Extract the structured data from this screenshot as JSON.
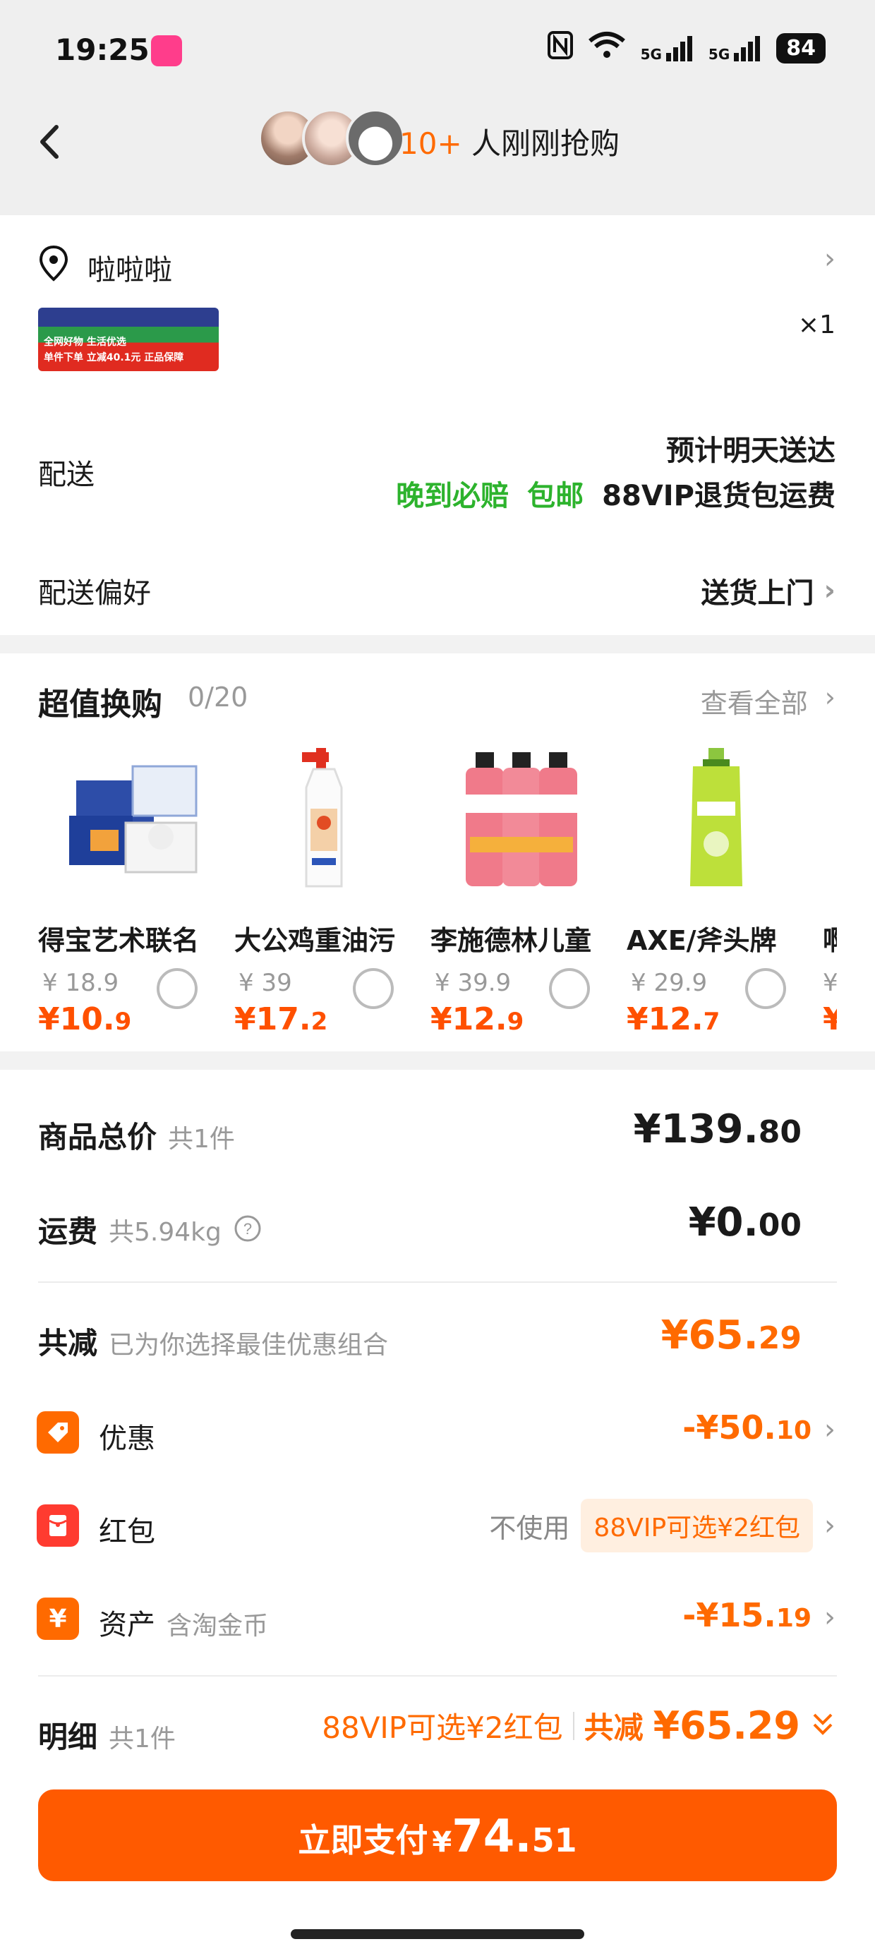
{
  "status_bar": {
    "time": "19:25",
    "app_badge": "淘宝 618",
    "network_1": "5G",
    "network_2": "5G",
    "battery": "84"
  },
  "header": {
    "buyers_count": "10+",
    "buyers_text": " 人刚刚抢购"
  },
  "address": {
    "name": "啦啦啦"
  },
  "product": {
    "image_lines": [
      "全网好物 生活优选",
      "单件下单 立减40.1元 正品保障"
    ],
    "quantity": "×1"
  },
  "shipping": {
    "label": "配送",
    "eta": "预计明天送达",
    "tag_late_comp": "晚到必赔",
    "tag_free": "包邮",
    "tag_vip": "88VIP退货包运费",
    "pref_label": "配送偏好",
    "pref_value": "送货上门"
  },
  "deals": {
    "title": "超值换购",
    "count": "0/20",
    "view_all": "查看全部",
    "items": [
      {
        "name": "得宝艺术联名",
        "orig": "¥ 18.9",
        "price_int": "¥10.",
        "price_dec": "9"
      },
      {
        "name": "大公鸡重油污",
        "orig": "¥ 39",
        "price_int": "¥17.",
        "price_dec": "2"
      },
      {
        "name": "李施德林儿童",
        "orig": "¥ 39.9",
        "price_int": "¥12.",
        "price_dec": "9"
      },
      {
        "name": "AXE/斧头牌",
        "orig": "¥ 29.9",
        "price_int": "¥12.",
        "price_dec": "7"
      },
      {
        "name": "啊",
        "orig": "¥",
        "price_int": "¥",
        "price_dec": ""
      }
    ]
  },
  "summary": {
    "goods_label": "商品总价",
    "goods_sub": "共1件",
    "goods_int": "¥139.",
    "goods_dec": "80",
    "freight_label": "运费",
    "freight_sub": "共5.94kg",
    "freight_int": "¥0.",
    "freight_dec": "00",
    "reduce_label": "共减",
    "reduce_sub": "已为你选择最佳优惠组合",
    "reduce_int": "¥65.",
    "reduce_dec": "29"
  },
  "discounts": {
    "promo_label": "优惠",
    "promo_int": "-¥50.",
    "promo_dec": "10",
    "redpacket_label": "红包",
    "redpacket_status": "不使用",
    "redpacket_pill": "88VIP可选¥2红包",
    "assets_label": "资产",
    "assets_sub": "含淘金币",
    "assets_int": "-¥15.",
    "assets_dec": "19"
  },
  "detail": {
    "label": "明细",
    "sub": "共1件",
    "vip": "88VIP可选¥2红包",
    "reduce_label": "共减",
    "reduce_value": "¥65.29"
  },
  "pay": {
    "label": "立即支付",
    "currency": "¥",
    "int": "74.",
    "dec": "51"
  },
  "colors": {
    "accent": "#ff5a00",
    "orange_text": "#ff6a00",
    "green": "#2db32d",
    "badge_red": "#ff3b30"
  }
}
